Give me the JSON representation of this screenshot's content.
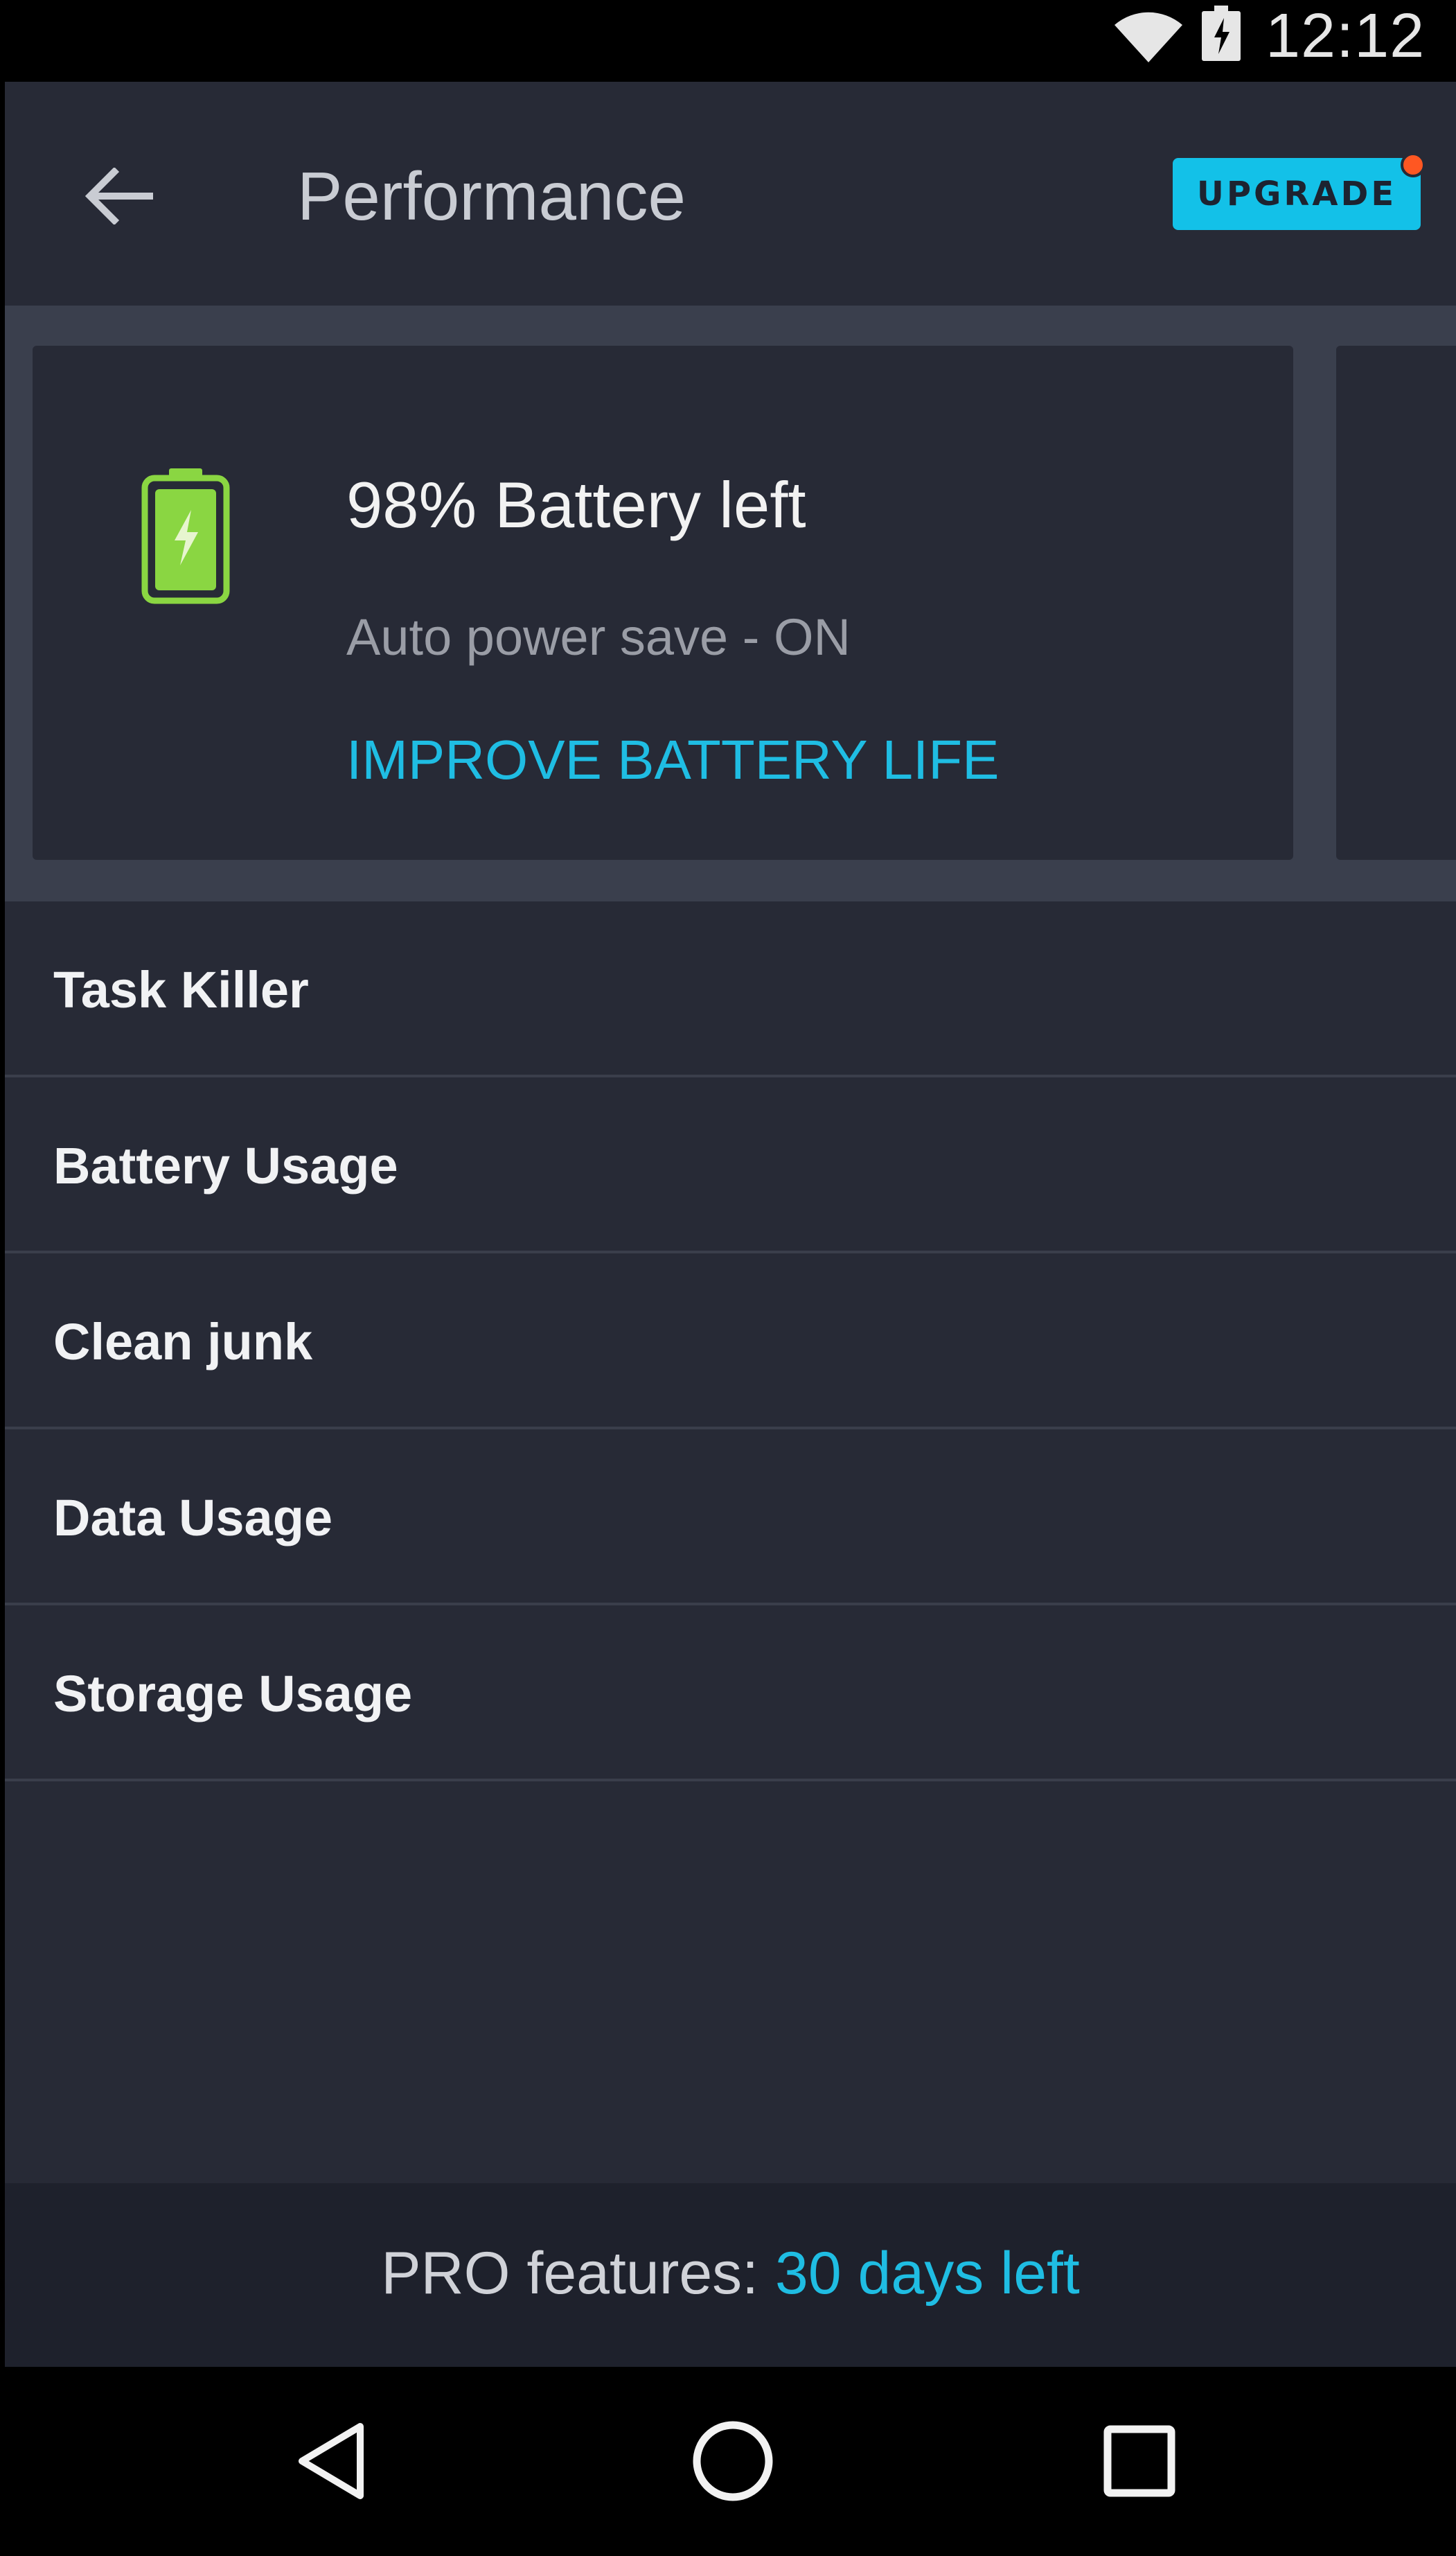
{
  "status_bar": {
    "time": "12:12",
    "icons": [
      "wifi-icon",
      "battery-charging-icon"
    ]
  },
  "app_bar": {
    "back_icon": "arrow-left-icon",
    "title": "Performance",
    "upgrade_label": "UPGRADE"
  },
  "battery_card": {
    "icon": "battery-charging-icon",
    "title": "98% Battery left",
    "subtitle": "Auto power save - ON",
    "action_label": "IMPROVE BATTERY LIFE"
  },
  "menu": {
    "items": [
      {
        "label": "Task Killer"
      },
      {
        "label": "Battery Usage"
      },
      {
        "label": "Clean junk"
      },
      {
        "label": "Data Usage"
      },
      {
        "label": "Storage Usage"
      }
    ]
  },
  "footer": {
    "prefix": "PRO features: ",
    "highlight": "30 days left"
  },
  "nav_bar": {
    "icons": [
      "nav-back-icon",
      "nav-home-icon",
      "nav-recents-icon"
    ]
  },
  "colors": {
    "background": "#272a36",
    "accent": "#1fbde3",
    "upgrade_button": "#13c1e8",
    "notification_dot": "#ff5722",
    "battery_green": "#8ad642"
  }
}
